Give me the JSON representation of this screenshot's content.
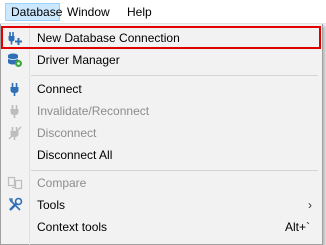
{
  "menubar": {
    "items": [
      {
        "label": "Database"
      },
      {
        "label": "Window"
      },
      {
        "label": "Help"
      }
    ]
  },
  "dropdown": {
    "items": [
      {
        "label": "New Database Connection",
        "icon": "new-connection-icon",
        "enabled": true,
        "highlighted": true
      },
      {
        "label": "Driver Manager",
        "icon": "driver-manager-icon",
        "enabled": true
      },
      {
        "label": "Connect",
        "icon": "connect-plug-icon",
        "enabled": true
      },
      {
        "label": "Invalidate/Reconnect",
        "icon": "reconnect-icon",
        "enabled": false
      },
      {
        "label": "Disconnect",
        "icon": "disconnect-icon",
        "enabled": false
      },
      {
        "label": "Disconnect All",
        "icon": "",
        "enabled": true
      },
      {
        "label": "Compare",
        "icon": "compare-icon",
        "enabled": false
      },
      {
        "label": "Tools",
        "icon": "tools-icon",
        "enabled": true,
        "submenu_arrow": "›"
      },
      {
        "label": "Context tools",
        "icon": "",
        "enabled": true,
        "shortcut": "Alt+`"
      }
    ]
  },
  "colors": {
    "highlight_border": "#e00000",
    "menubar_active_bg": "#cce8ff",
    "disabled_text": "#8c8c8c",
    "icon_blue": "#2f6fb5",
    "icon_green": "#3aa83a"
  }
}
